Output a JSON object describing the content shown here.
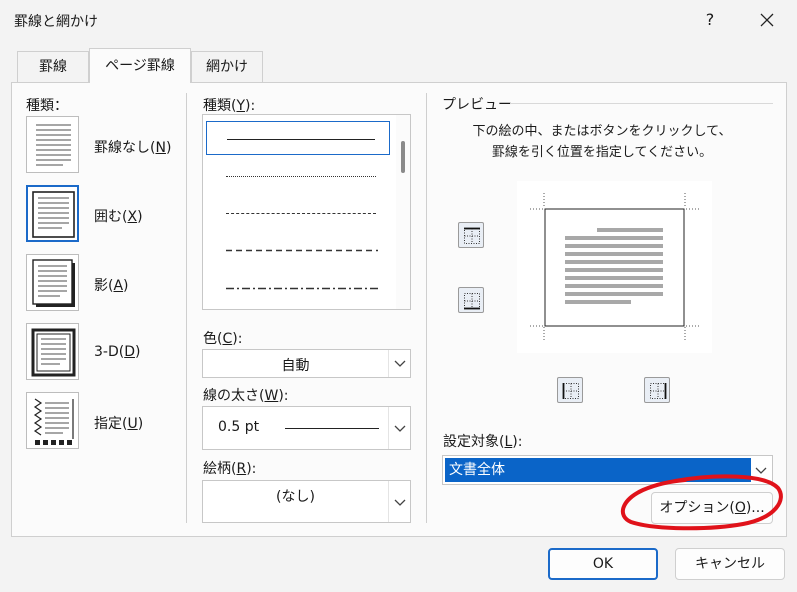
{
  "window": {
    "title": "罫線と網かけ",
    "help": "?",
    "close": "×"
  },
  "tabs": [
    {
      "label": "罫線",
      "active": false
    },
    {
      "label": "ページ罫線",
      "active": true
    },
    {
      "label": "網かけ",
      "active": false
    }
  ],
  "setting": {
    "label": "種類：",
    "items": [
      {
        "pre": "罫線なし(",
        "key": "N",
        "post": ")"
      },
      {
        "pre": "囲む(",
        "key": "X",
        "post": ")"
      },
      {
        "pre": "影(",
        "key": "A",
        "post": ")"
      },
      {
        "pre": "3-D(",
        "key": "D",
        "post": ")"
      },
      {
        "pre": "指定(",
        "key": "U",
        "post": ")"
      }
    ],
    "selected_index": 1
  },
  "style": {
    "label_pre": "種類(",
    "label_key": "Y",
    "label_post": "):",
    "lines": [
      "solid",
      "dotted",
      "dashed-small",
      "dashed",
      "dash-dot"
    ],
    "selected_index": 0
  },
  "color": {
    "label_pre": "色(",
    "label_key": "C",
    "label_post": "):",
    "value": "自動"
  },
  "width": {
    "label_pre": "線の太さ(",
    "label_key": "W",
    "label_post": "):",
    "value": "0.5 pt"
  },
  "art": {
    "label_pre": "絵柄(",
    "label_key": "R",
    "label_post": "):",
    "value": "(なし)"
  },
  "preview": {
    "label": "プレビュー",
    "instruction_line1": "下の絵の中、またはボタンをクリックして、",
    "instruction_line2": "罫線を引く位置を指定してください。"
  },
  "apply_to": {
    "label_pre": "設定対象(",
    "label_key": "L",
    "label_post": "):",
    "value": "文書全体"
  },
  "options_button": {
    "pre": "オプション(",
    "key": "O",
    "post": ")..."
  },
  "ok_button": "OK",
  "cancel_button": "キャンセル",
  "colors": {
    "accent": "#1b6ac9",
    "selection": "#0a64c8",
    "annotation": "#e0121a"
  }
}
